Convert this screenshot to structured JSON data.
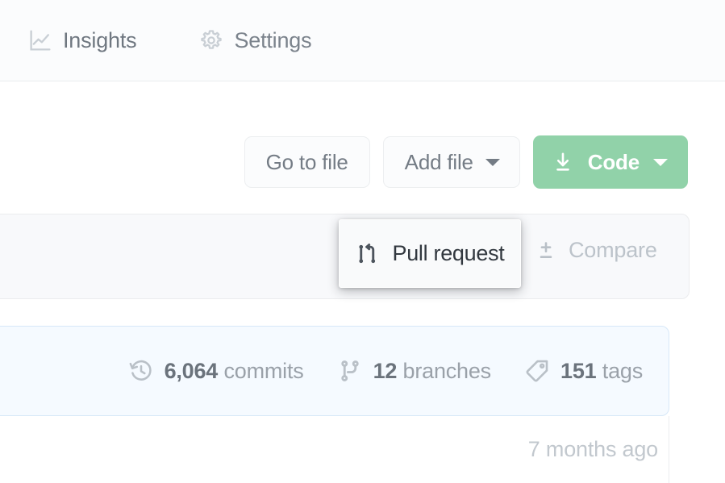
{
  "nav": {
    "tabs": [
      {
        "id": "insights",
        "label": "Insights",
        "icon": "graph-icon"
      },
      {
        "id": "settings",
        "label": "Settings",
        "icon": "gear-icon"
      }
    ]
  },
  "file_actions": {
    "go_to_file_label": "Go to file",
    "add_file_label": "Add file",
    "code_label": "Code",
    "code_icon": "download-icon",
    "dropdown_icon": "chevron-down-icon"
  },
  "branch_toolbar": {
    "pull_request_label": "Pull request",
    "pull_request_icon": "git-pull-request-icon",
    "compare_label": "Compare",
    "compare_icon": "plus-minus-diff-icon"
  },
  "stats": [
    {
      "id": "commits",
      "value": "6,064",
      "unit": "commits",
      "icon": "history-clock-icon"
    },
    {
      "id": "branches",
      "value": "12",
      "unit": "branches",
      "icon": "git-branch-icon"
    },
    {
      "id": "tags",
      "value": "151",
      "unit": "tags",
      "icon": "tag-icon"
    }
  ],
  "latest_commit": {
    "time_label": "7 months ago"
  },
  "colors": {
    "code_button_green": "#91d2a9",
    "stats_bar_background": "#f5faff",
    "stats_bar_border": "#d7e8f8",
    "toolbar_background": "#f8f9fb",
    "muted_text": "#9aa1a9"
  }
}
